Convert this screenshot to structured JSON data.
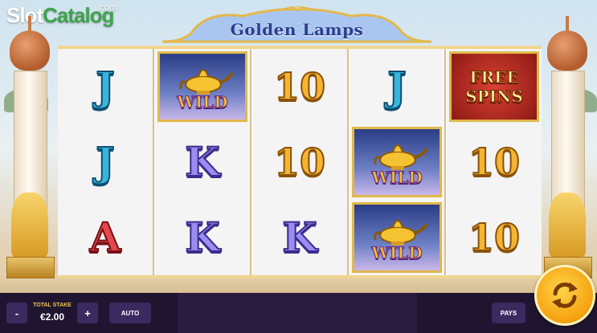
{
  "logo": {
    "slot": "Slot",
    "catalog": "Catalog",
    "dotcom": ".com"
  },
  "game": {
    "title": "Golden Lamps"
  },
  "reels": [
    [
      {
        "type": "letter",
        "text": "J",
        "color": "#37b5dc"
      },
      {
        "type": "letter",
        "text": "J",
        "color": "#37b5dc"
      },
      {
        "type": "letter",
        "text": "A",
        "color": "#e5474d"
      }
    ],
    [
      {
        "type": "wild",
        "text": "WILD"
      },
      {
        "type": "letter",
        "text": "K",
        "color": "#9a8cf0"
      },
      {
        "type": "letter",
        "text": "K",
        "color": "#9a8cf0"
      }
    ],
    [
      {
        "type": "number",
        "text": "10",
        "color": "#f5b534"
      },
      {
        "type": "number",
        "text": "10",
        "color": "#f5b534"
      },
      {
        "type": "letter",
        "text": "K",
        "color": "#9a8cf0"
      }
    ],
    [
      {
        "type": "letter",
        "text": "J",
        "color": "#37b5dc"
      },
      {
        "type": "wild",
        "text": "WILD"
      },
      {
        "type": "wild",
        "text": "WILD"
      }
    ],
    [
      {
        "type": "freespins",
        "line1": "FREE",
        "line2": "SPINS"
      },
      {
        "type": "number",
        "text": "10",
        "color": "#f5b534"
      },
      {
        "type": "number",
        "text": "10",
        "color": "#f5b534"
      }
    ]
  ],
  "controls": {
    "minus_label": "-",
    "plus_label": "+",
    "stake_label": "TOTAL STAKE",
    "stake_value": "€2.00",
    "auto_label": "AUTO",
    "pays_label": "PAYS",
    "spin_icon": "spin-arrows-icon"
  }
}
